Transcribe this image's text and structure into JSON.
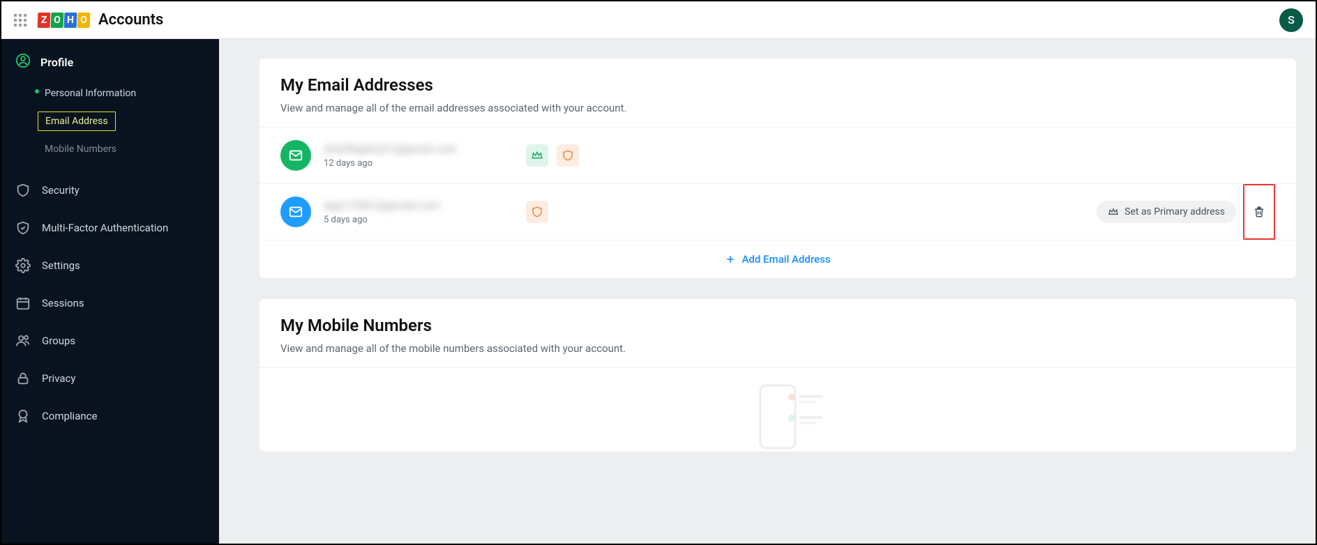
{
  "header": {
    "app_title": "Accounts",
    "avatar_initial": "S",
    "logo_letters": [
      "Z",
      "O",
      "H",
      "O"
    ]
  },
  "sidebar": {
    "profile_label": "Profile",
    "personal_info": "Personal Information",
    "email_address": "Email Address",
    "mobile_numbers": "Mobile Numbers",
    "items": [
      {
        "label": "Security"
      },
      {
        "label": "Multi-Factor Authentication"
      },
      {
        "label": "Settings"
      },
      {
        "label": "Sessions"
      },
      {
        "label": "Groups"
      },
      {
        "label": "Privacy"
      },
      {
        "label": "Compliance"
      }
    ]
  },
  "emails_section": {
    "title": "My Email Addresses",
    "subtitle": "View and manage all of the email addresses associated with your account.",
    "rows": [
      {
        "address": "sharfleglery01@gmail.com",
        "ago": "12 days ago",
        "primary": true
      },
      {
        "address": "appr15561@gmail.com",
        "ago": "5 days ago",
        "primary": false
      }
    ],
    "set_primary_label": "Set as Primary address",
    "add_label": "Add Email Address"
  },
  "mobiles_section": {
    "title": "My Mobile Numbers",
    "subtitle": "View and manage all of the mobile numbers associated with your account."
  }
}
